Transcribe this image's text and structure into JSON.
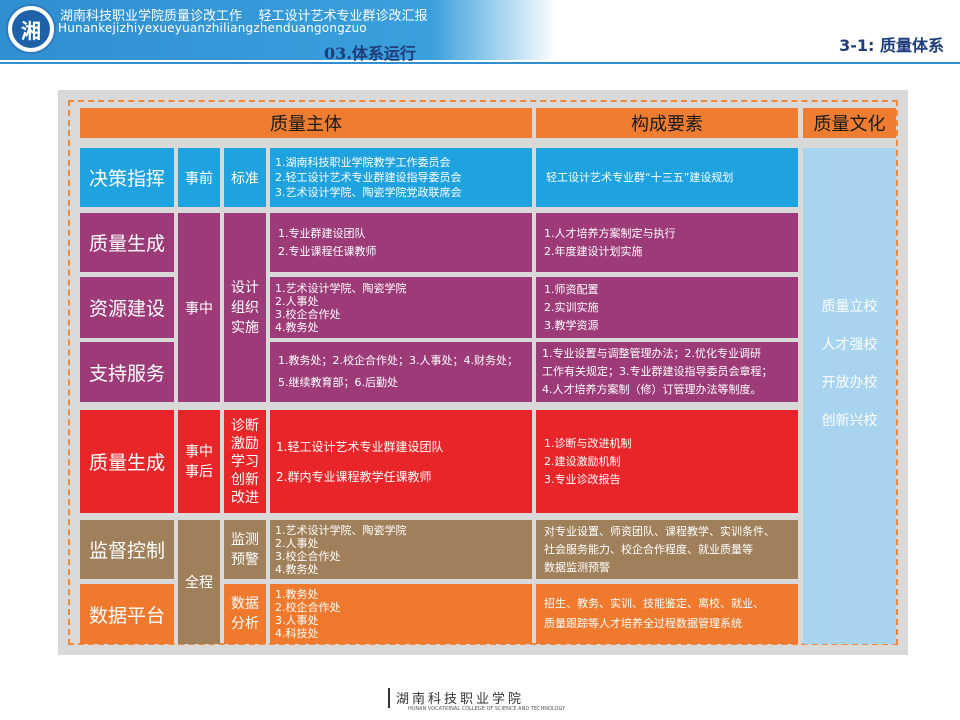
{
  "header": {
    "title": "湖南科技职业学院质量诊改工作    轻工设计艺术专业群诊改汇报",
    "pinyin": "Hunankejizhiyexueyuanzhiliangzhenduangongzuo",
    "section": "03.体系运行",
    "right": "3-1: 质量体系",
    "logo_glyph": "湘"
  },
  "colors": {
    "accent_orange": "#ee7d31",
    "blue": "#1ea3e0",
    "purple": "#9d3b79",
    "red": "#e8262a",
    "brown": "#a0805b",
    "light_blue": "#a8d4f0"
  },
  "table": {
    "headers": [
      "质量主体",
      "构成要素",
      "质量文化"
    ],
    "rows": {
      "decision": {
        "name": "决策指挥",
        "phase": "事前",
        "method": "标准",
        "subjects": [
          "1.湖南科技职业学院教学工作委员会",
          "2.轻工设计艺术专业群建设指导委员会",
          "3.艺术设计学院、陶瓷学院党政联席会"
        ],
        "elements": [
          "轻工设计艺术专业群“十三五”建设规划"
        ]
      },
      "quality_gen1": {
        "name": "质量生成",
        "subjects": [
          "1.专业群建设团队",
          "2.专业课程任课教师"
        ],
        "elements": [
          "1.人才培养方案制定与执行",
          "2.年度建设计划实施"
        ]
      },
      "resource": {
        "name": "资源建设",
        "subjects": [
          "1.艺术设计学院、陶瓷学院",
          "2.人事处",
          "3.校企合作处",
          "4.教务处"
        ],
        "elements": [
          "1.师资配置",
          "2.实训实施",
          "3.教学资源"
        ]
      },
      "support": {
        "name": "支持服务",
        "subjects": [
          "1.教务处；2.校企合作处；3.人事处；4.财务处；",
          "5.继续教育部；6.后勤处"
        ],
        "elements": [
          "1.专业设置与调整管理办法；2.优化专业调研",
          "工作有关规定；3.专业群建设指导委员会章程；",
          "4.人才培养方案制（修）订管理办法等制度。"
        ]
      },
      "middle": {
        "phase": "事中",
        "method": [
          "设计",
          "组织",
          "实施"
        ]
      },
      "quality_gen2": {
        "name": "质量生成",
        "phase": [
          "事中",
          "事后"
        ],
        "method": [
          "诊断",
          "激励",
          "学习",
          "创新",
          "改进"
        ],
        "subjects": [
          "1.轻工设计艺术专业群建设团队",
          "2.群内专业课程教学任课教师"
        ],
        "elements": [
          "1.诊断与改进机制",
          "2.建设激励机制",
          "3.专业诊改报告"
        ]
      },
      "supervision": {
        "name": "监督控制",
        "method": [
          "监测",
          "预警"
        ],
        "subjects": [
          "1.艺术设计学院、陶瓷学院",
          "2.人事处",
          "3.校企合作处",
          "4.教务处"
        ],
        "elements": [
          "对专业设置、师资团队、课程教学、实训条件、",
          "社会服务能力、校企合作程度、就业质量等",
          "数据监测预警"
        ]
      },
      "platform": {
        "name": "数据平台",
        "method": [
          "数据",
          "分析"
        ],
        "subjects": [
          "1.教务处",
          "2.校企合作处",
          "3.人事处",
          "4.科技处"
        ],
        "elements": [
          "招生、教务、实训、技能鉴定、离校、就业、",
          "质量跟踪等人才培养全过程数据管理系统"
        ]
      },
      "whole": {
        "phase": "全程"
      }
    },
    "culture": [
      "质量立校",
      "人才强校",
      "开放办校",
      "创新兴校"
    ]
  },
  "footer": {
    "name": "湖南科技职业学院",
    "english": "HUNAN VOCATIONAL COLLEGE OF SCIENCE AND TECHNOLOGY"
  }
}
